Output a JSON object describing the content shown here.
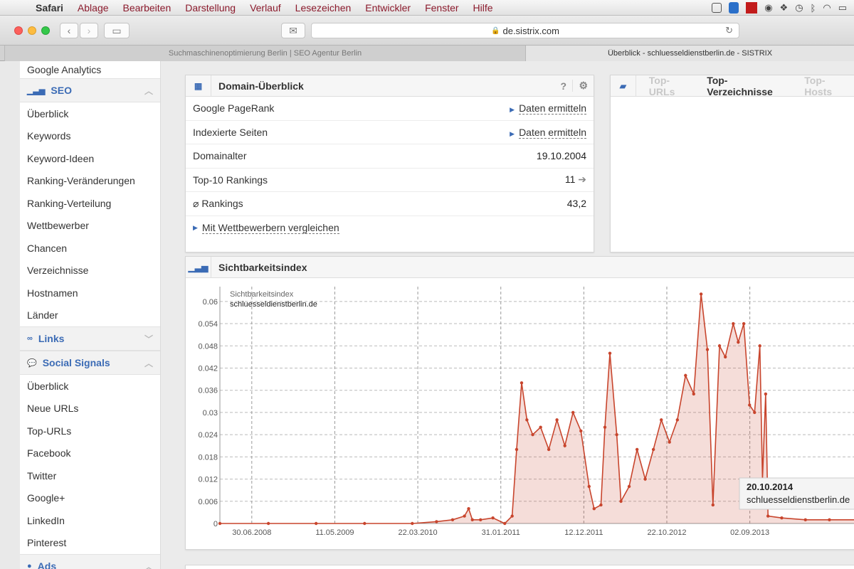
{
  "menubar": {
    "items": [
      "Safari",
      "Ablage",
      "Bearbeiten",
      "Darstellung",
      "Verlauf",
      "Lesezeichen",
      "Entwickler",
      "Fenster",
      "Hilfe"
    ]
  },
  "toolbar": {
    "url": "de.sistrix.com"
  },
  "tabs": [
    {
      "label": "Suchmaschinenoptimierung Berlin | SEO Agentur Berlin"
    },
    {
      "label": "Überblick - schluesseldienstberlin.de - SISTRIX"
    }
  ],
  "sidebar": {
    "top_item": "Google Analytics",
    "seo": {
      "label": "SEO",
      "items": [
        "Überblick",
        "Keywords",
        "Keyword-Ideen",
        "Ranking-Veränderungen",
        "Ranking-Verteilung",
        "Wettbewerber",
        "Chancen",
        "Verzeichnisse",
        "Hostnamen",
        "Länder"
      ]
    },
    "links": {
      "label": "Links"
    },
    "social": {
      "label": "Social Signals",
      "items": [
        "Überblick",
        "Neue URLs",
        "Top-URLs",
        "Facebook",
        "Twitter",
        "Google+",
        "LinkedIn",
        "Pinterest"
      ]
    },
    "ads": {
      "label": "Ads"
    }
  },
  "domain_panel": {
    "title": "Domain-Überblick",
    "help": "?",
    "rows": [
      {
        "label": "Google PageRank",
        "value": "Daten ermitteln"
      },
      {
        "label": "Indexierte Seiten",
        "value": "Daten ermitteln"
      },
      {
        "label": "Domainalter",
        "value": "19.10.2004"
      },
      {
        "label": "Top-10 Rankings",
        "value": "11"
      },
      {
        "label": "⌀ Rankings",
        "value": "43,2"
      }
    ],
    "compare_link": "Mit Wettbewerbern vergleichen"
  },
  "top_panel": {
    "tabs": [
      "Top-URLs",
      "Top-Verzeichnisse",
      "Top-Hosts"
    ],
    "selected": "Top-Verzeichnisse"
  },
  "chart_panel": {
    "title": "Sichtbarkeitsindex"
  },
  "chart_data": {
    "type": "area",
    "title": "Sichtbarkeitsindex",
    "series_label": "Sichtbarkeitsindex",
    "series": [
      {
        "name": "schluesseldienstberlin.de",
        "color": "#c8452d"
      }
    ],
    "x_ticks": [
      "30.06.2008",
      "11.05.2009",
      "22.03.2010",
      "31.01.2011",
      "12.12.2011",
      "22.10.2012",
      "02.09.2013"
    ],
    "y_ticks": [
      "0",
      "0.006",
      "0.012",
      "0.018",
      "0.024",
      "0.03",
      "0.036",
      "0.042",
      "0.048",
      "0.054",
      "0.06"
    ],
    "ylim": [
      0,
      0.064
    ],
    "grid": true,
    "points": [
      [
        "2008-03-01",
        0
      ],
      [
        "2008-09-01",
        0
      ],
      [
        "2009-03-01",
        0
      ],
      [
        "2009-09-01",
        0
      ],
      [
        "2010-03-01",
        0
      ],
      [
        "2010-06-01",
        0.0005
      ],
      [
        "2010-08-01",
        0.001
      ],
      [
        "2010-09-15",
        0.002
      ],
      [
        "2010-10-01",
        0.004
      ],
      [
        "2010-10-15",
        0.001
      ],
      [
        "2010-11-15",
        0.001
      ],
      [
        "2011-01-01",
        0.0015
      ],
      [
        "2011-02-15",
        0
      ],
      [
        "2011-03-15",
        0.002
      ],
      [
        "2011-04-01",
        0.02
      ],
      [
        "2011-04-20",
        0.038
      ],
      [
        "2011-05-10",
        0.028
      ],
      [
        "2011-06-01",
        0.024
      ],
      [
        "2011-07-01",
        0.026
      ],
      [
        "2011-08-01",
        0.02
      ],
      [
        "2011-09-01",
        0.028
      ],
      [
        "2011-10-01",
        0.021
      ],
      [
        "2011-11-01",
        0.03
      ],
      [
        "2011-12-01",
        0.025
      ],
      [
        "2012-01-01",
        0.01
      ],
      [
        "2012-01-20",
        0.004
      ],
      [
        "2012-02-15",
        0.005
      ],
      [
        "2012-03-01",
        0.026
      ],
      [
        "2012-03-20",
        0.046
      ],
      [
        "2012-04-15",
        0.024
      ],
      [
        "2012-05-01",
        0.006
      ],
      [
        "2012-06-01",
        0.01
      ],
      [
        "2012-07-01",
        0.02
      ],
      [
        "2012-08-01",
        0.012
      ],
      [
        "2012-09-01",
        0.02
      ],
      [
        "2012-10-01",
        0.028
      ],
      [
        "2012-11-01",
        0.022
      ],
      [
        "2012-12-01",
        0.028
      ],
      [
        "2013-01-01",
        0.04
      ],
      [
        "2013-02-01",
        0.035
      ],
      [
        "2013-03-01",
        0.062
      ],
      [
        "2013-03-25",
        0.047
      ],
      [
        "2013-04-15",
        0.005
      ],
      [
        "2013-05-10",
        0.048
      ],
      [
        "2013-06-01",
        0.045
      ],
      [
        "2013-07-01",
        0.054
      ],
      [
        "2013-07-20",
        0.049
      ],
      [
        "2013-08-10",
        0.054
      ],
      [
        "2013-09-01",
        0.032
      ],
      [
        "2013-09-20",
        0.03
      ],
      [
        "2013-10-10",
        0.048
      ],
      [
        "2013-10-20",
        0.012
      ],
      [
        "2013-11-01",
        0.035
      ],
      [
        "2013-11-10",
        0.002
      ],
      [
        "2014-01-01",
        0.0015
      ],
      [
        "2014-04-01",
        0.001
      ],
      [
        "2014-07-01",
        0.001
      ],
      [
        "2014-10-20",
        0.001
      ]
    ],
    "tooltip": {
      "date": "20.10.2014",
      "label": "schluesseldienstberlin.de"
    }
  }
}
